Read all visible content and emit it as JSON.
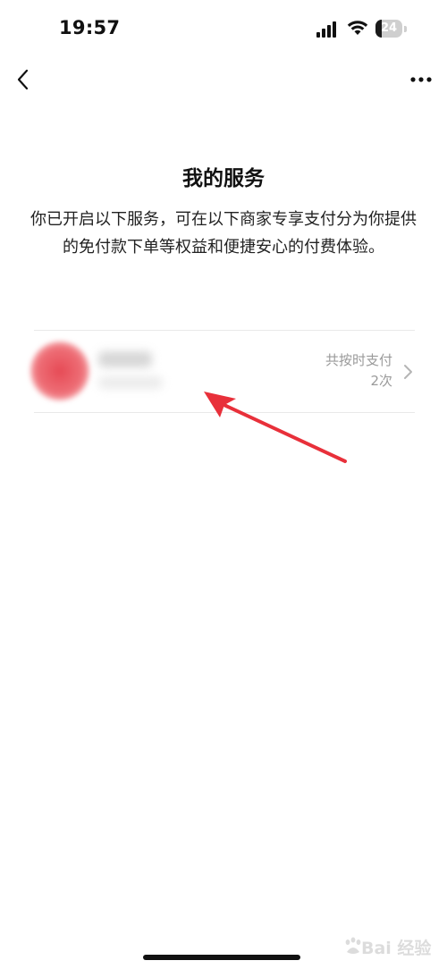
{
  "status_bar": {
    "time": "19:57",
    "battery_level": "24",
    "battery_fraction": 0.24
  },
  "icons": {
    "back": "chevron-left-icon",
    "more": "more-horizontal-icon",
    "signal": "cellular-signal-icon",
    "wifi": "wifi-icon",
    "battery": "battery-icon",
    "item_chevron": "chevron-right-icon"
  },
  "page": {
    "title": "我的服务",
    "description": "你已开启以下服务，可在以下商家专享支付分为你提供的免付款下单等权益和便捷安心的付费体验。"
  },
  "services": [
    {
      "merchant_name": "",
      "payment_summary_line1": "共按时支付",
      "payment_summary_line2": "2次"
    }
  ],
  "watermark": {
    "text": "Bai 经验"
  },
  "colors": {
    "text_primary": "#111111",
    "text_secondary": "#9a9a9a",
    "divider": "#e9e9e9",
    "annotation_red": "#e8303a",
    "avatar_red": "#e64a55"
  }
}
